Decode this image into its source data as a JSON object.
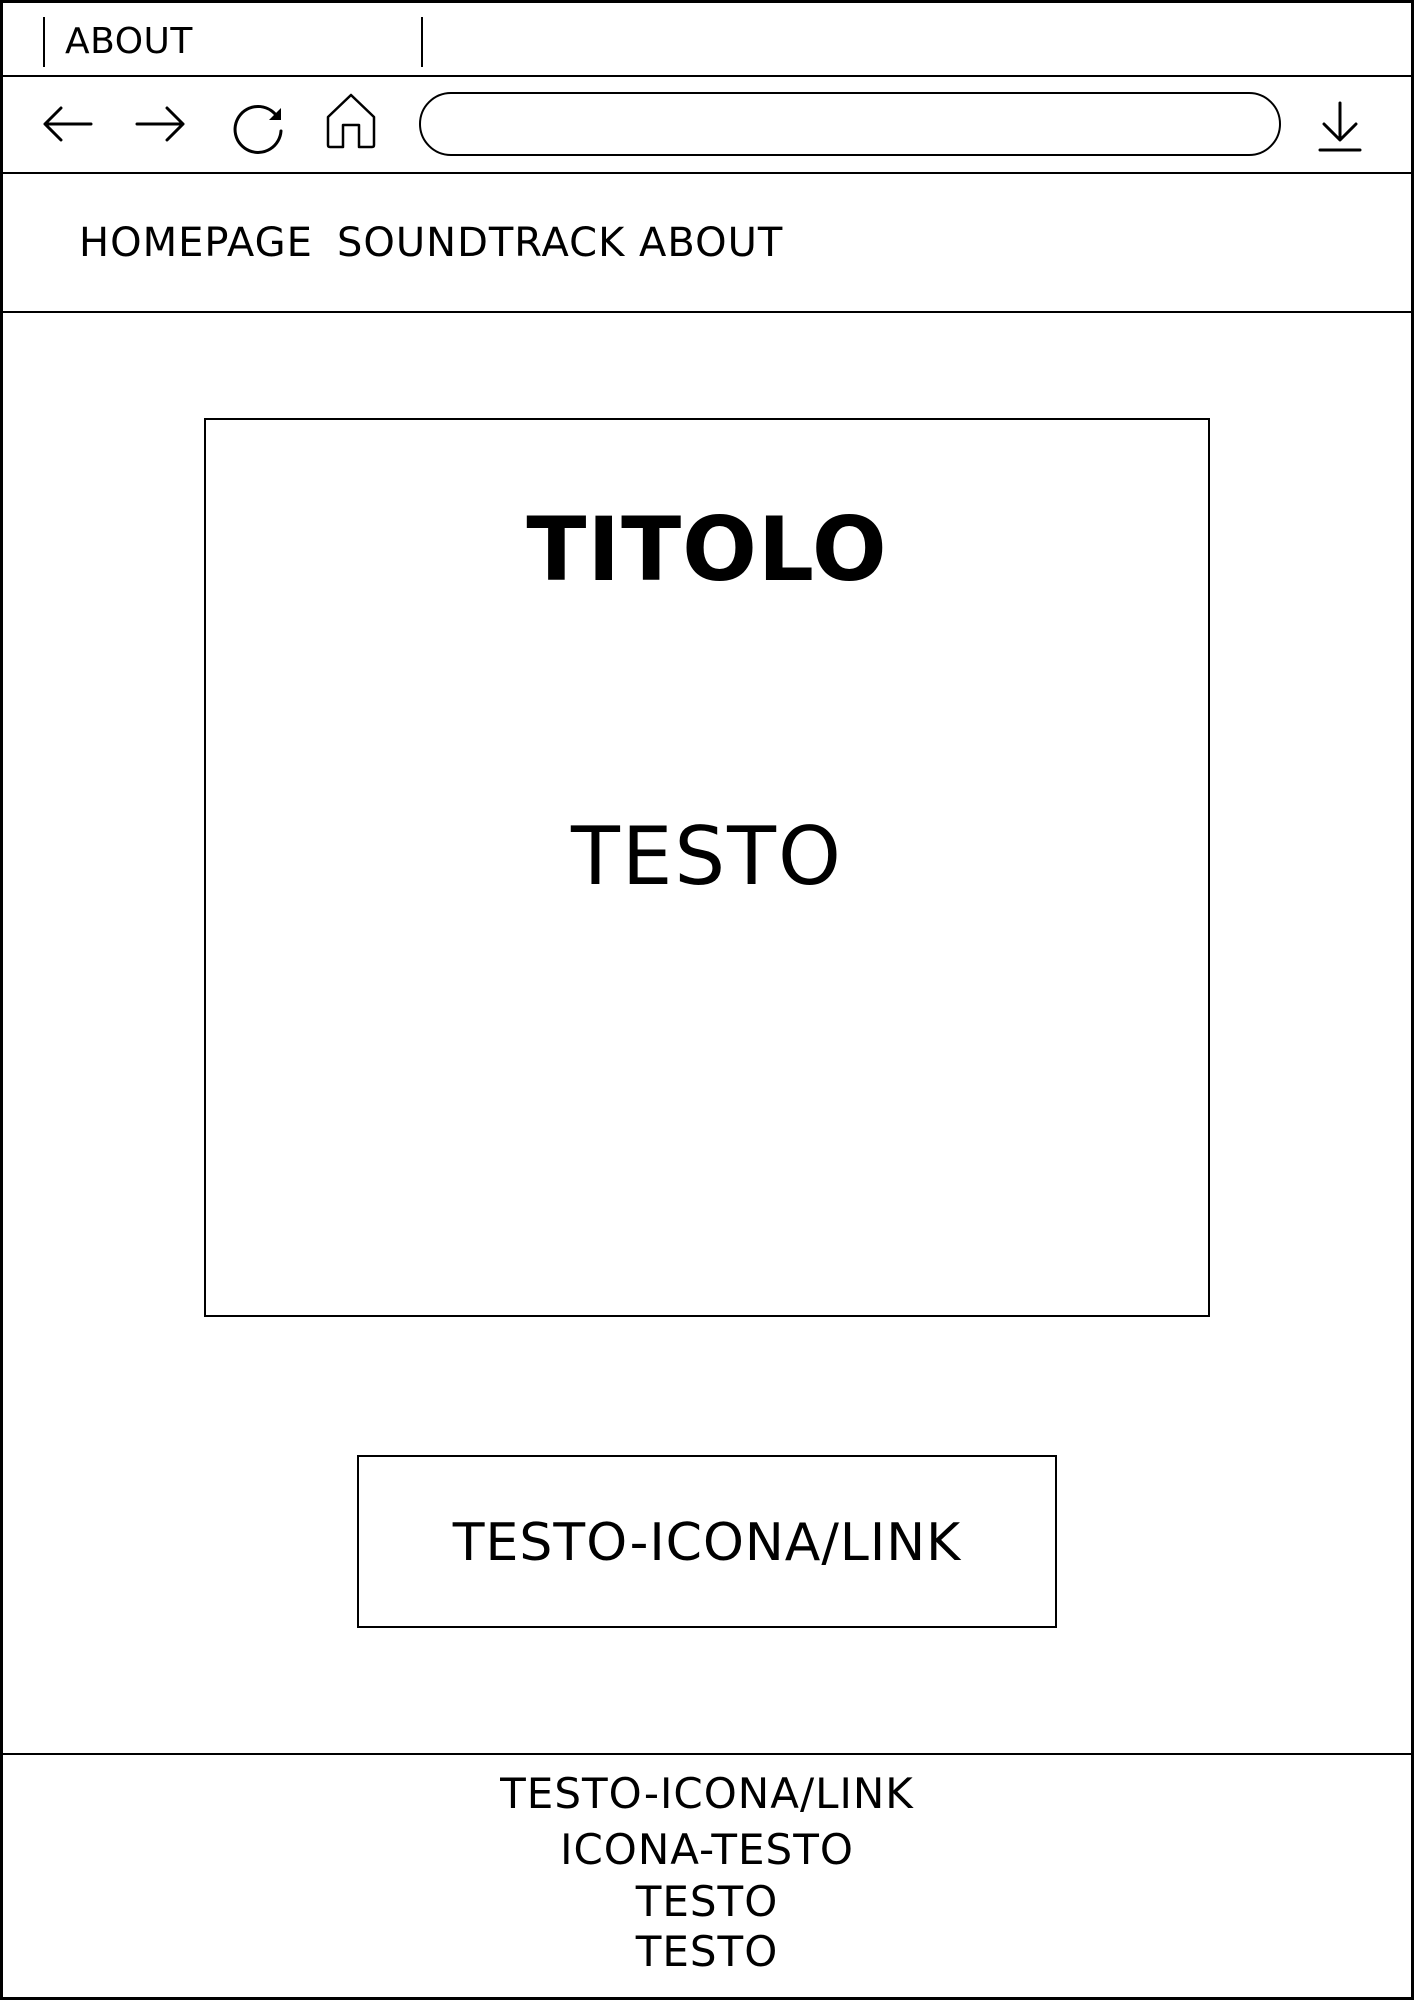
{
  "browser": {
    "tab": {
      "label": "ABOUT"
    },
    "toolbar": {
      "back_icon": "arrow-left-icon",
      "forward_icon": "arrow-right-icon",
      "reload_icon": "reload-icon",
      "home_icon": "home-icon",
      "address_value": "",
      "download_icon": "download-icon"
    }
  },
  "nav": {
    "items": [
      {
        "label": "HOMEPAGE"
      },
      {
        "label": "SOUNDTRACK"
      },
      {
        "label": "ABOUT"
      }
    ]
  },
  "main": {
    "title": "TITOLO",
    "text": "TESTO",
    "link_box_label": "TESTO-ICONA/LINK"
  },
  "footer": {
    "lines": [
      "TESTO-ICONA/LINK",
      "ICONA-TESTO",
      "TESTO",
      "TESTO"
    ]
  },
  "colors": {
    "stroke": "#000000",
    "background": "#ffffff"
  }
}
